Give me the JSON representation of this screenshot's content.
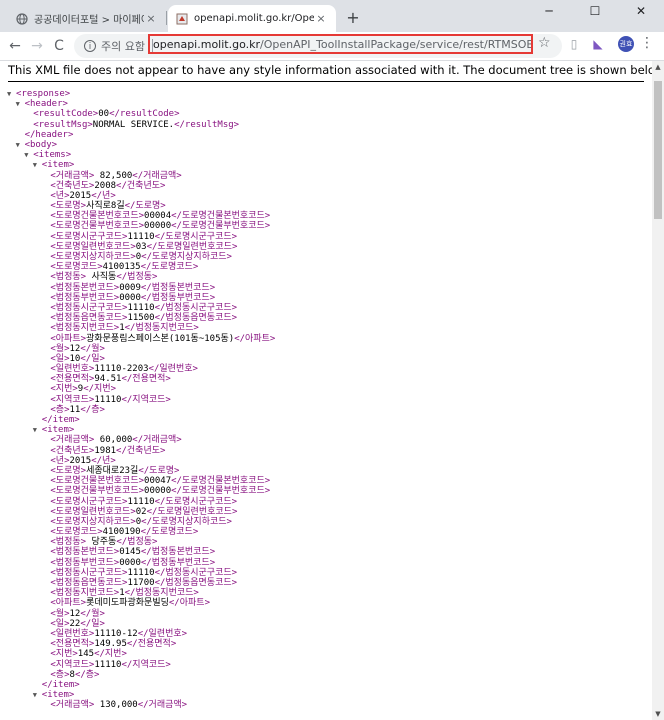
{
  "browser": {
    "tabs": [
      {
        "title": "공공데이터포털 > 마이페이지 > 개",
        "active": false,
        "icon": "globe-icon"
      },
      {
        "title": "openapi.molit.go.kr/OpenAPI_To",
        "active": true,
        "icon": "page-icon"
      }
    ],
    "close_glyph": "×",
    "new_tab_glyph": "+",
    "window_controls": {
      "minimize": "─",
      "maximize": "☐",
      "close": "✕"
    },
    "nav": {
      "back": "←",
      "forward": "→",
      "reload": "C"
    },
    "omnibox": {
      "info_glyph": "i",
      "status": "주의 요함",
      "url_host": "openapi.molit.go.kr",
      "url_path": "/OpenAPI_ToolInstallPackage/service/rest/RTMSOBJSvc/getRTMS..."
    },
    "star_glyph": "☆",
    "extensions": [
      "▯",
      "◣"
    ],
    "avatar_text": "권효",
    "menu_glyph": "⋮"
  },
  "notice": "This XML file does not appear to have any style information associated with it. The document tree is shown below.",
  "tree": {
    "toggle_glyph": "▼",
    "response_tag": "response",
    "header_tag": "header",
    "header_fields": [
      {
        "tag": "resultCode",
        "value": "00"
      },
      {
        "tag": "resultMsg",
        "value": "NORMAL SERVICE."
      }
    ],
    "body_tag": "body",
    "items_tag": "items",
    "item_tag": "item",
    "items": [
      {
        "fields": [
          {
            "tag": "거래금액",
            "value": " 82,500"
          },
          {
            "tag": "건축년도",
            "value": "2008"
          },
          {
            "tag": "년",
            "value": "2015"
          },
          {
            "tag": "도로명",
            "value": "사직로8길"
          },
          {
            "tag": "도로명건물본번호코드",
            "value": "00004"
          },
          {
            "tag": "도로명건물부번호코드",
            "value": "00000"
          },
          {
            "tag": "도로명시군구코드",
            "value": "11110"
          },
          {
            "tag": "도로명일련번호코드",
            "value": "03"
          },
          {
            "tag": "도로명지상지하코드",
            "value": "0"
          },
          {
            "tag": "도로명코드",
            "value": "4100135"
          },
          {
            "tag": "법정동",
            "value": " 사직동"
          },
          {
            "tag": "법정동본번코드",
            "value": "0009"
          },
          {
            "tag": "법정동부번코드",
            "value": "0000"
          },
          {
            "tag": "법정동시군구코드",
            "value": "11110"
          },
          {
            "tag": "법정동읍면동코드",
            "value": "11500"
          },
          {
            "tag": "법정동지번코드",
            "value": "1"
          },
          {
            "tag": "아파트",
            "value": "광화문풍림스페이스본(101동~105동)"
          },
          {
            "tag": "월",
            "value": "12"
          },
          {
            "tag": "일",
            "value": "10"
          },
          {
            "tag": "일련번호",
            "value": "11110-2203"
          },
          {
            "tag": "전용면적",
            "value": "94.51"
          },
          {
            "tag": "지번",
            "value": "9"
          },
          {
            "tag": "지역코드",
            "value": "11110"
          },
          {
            "tag": "층",
            "value": "11"
          }
        ]
      },
      {
        "fields": [
          {
            "tag": "거래금액",
            "value": " 60,000"
          },
          {
            "tag": "건축년도",
            "value": "1981"
          },
          {
            "tag": "년",
            "value": "2015"
          },
          {
            "tag": "도로명",
            "value": "세종대로23길"
          },
          {
            "tag": "도로명건물본번호코드",
            "value": "00047"
          },
          {
            "tag": "도로명건물부번호코드",
            "value": "00000"
          },
          {
            "tag": "도로명시군구코드",
            "value": "11110"
          },
          {
            "tag": "도로명일련번호코드",
            "value": "02"
          },
          {
            "tag": "도로명지상지하코드",
            "value": "0"
          },
          {
            "tag": "도로명코드",
            "value": "4100190"
          },
          {
            "tag": "법정동",
            "value": " 당주동"
          },
          {
            "tag": "법정동본번코드",
            "value": "0145"
          },
          {
            "tag": "법정동부번코드",
            "value": "0000"
          },
          {
            "tag": "법정동시군구코드",
            "value": "11110"
          },
          {
            "tag": "법정동읍면동코드",
            "value": "11700"
          },
          {
            "tag": "법정동지번코드",
            "value": "1"
          },
          {
            "tag": "아파트",
            "value": "롯데미도파광화문빌딩"
          },
          {
            "tag": "월",
            "value": "12"
          },
          {
            "tag": "일",
            "value": "22"
          },
          {
            "tag": "일련번호",
            "value": "11110-12"
          },
          {
            "tag": "전용면적",
            "value": "149.95"
          },
          {
            "tag": "지번",
            "value": "145"
          },
          {
            "tag": "지역코드",
            "value": "11110"
          },
          {
            "tag": "층",
            "value": "8"
          }
        ]
      },
      {
        "fields": [
          {
            "tag": "거래금액",
            "value": " 130,000"
          }
        ]
      }
    ]
  },
  "scrollbar": {
    "up": "▲",
    "down": "▼"
  }
}
